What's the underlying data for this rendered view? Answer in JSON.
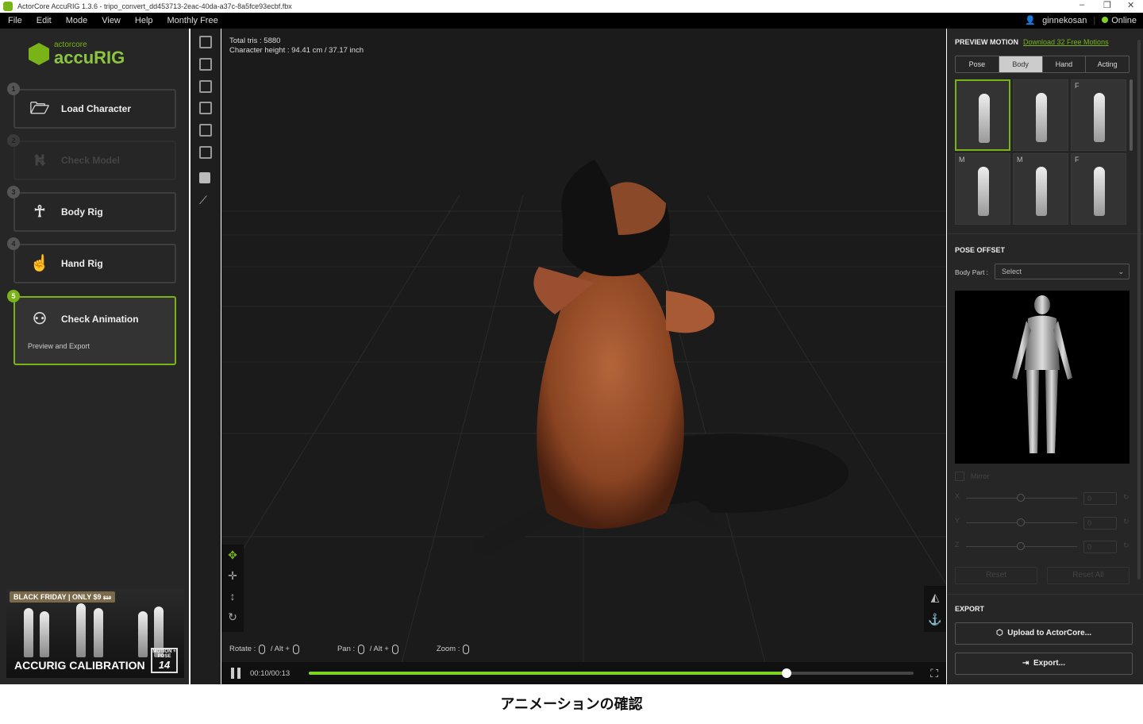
{
  "window": {
    "title": "ActorCore AccuRIG 1.3.6 - tripo_convert_dd453713-2eac-40da-a37c-8a5fce93ecbf.fbx",
    "minimize": "–",
    "restore": "❐",
    "close": "✕"
  },
  "menu": {
    "items": [
      "File",
      "Edit",
      "Mode",
      "View",
      "Help",
      "Monthly Free"
    ],
    "user": "ginnekosan",
    "status": "Online"
  },
  "logo": {
    "brand": "actorcore",
    "product": "accuRIG",
    "color": "#7ab317"
  },
  "steps": [
    {
      "num": "1",
      "label": "Load Character",
      "icon": "folder-download-icon",
      "state": "enabled"
    },
    {
      "num": "2",
      "label": "Check Model",
      "icon": "tpose-icon",
      "state": "disabled"
    },
    {
      "num": "3",
      "label": "Body Rig",
      "icon": "body-icon",
      "state": "enabled"
    },
    {
      "num": "4",
      "label": "Hand Rig",
      "icon": "hand-icon",
      "state": "enabled"
    },
    {
      "num": "5",
      "label": "Check Animation",
      "sublabel": "Preview and Export",
      "icon": "user-check-icon",
      "state": "active"
    }
  ],
  "banner": {
    "tag": "BLACK FRIDAY | ONLY $9",
    "old_price": "$19",
    "title": "ACCURIG CALIBRATION",
    "badge_top": "MOTION + POSE",
    "badge_num": "14"
  },
  "viewport": {
    "tris": "Total tris : 5880",
    "height": "Character height : 94.41 cm / 37.17 inch",
    "hints": {
      "rotate": "Rotate :",
      "pan": "Pan :",
      "zoom": "Zoom :",
      "alt": "/ Alt +"
    },
    "time": "00:10/00:13",
    "progress": 0.79
  },
  "right": {
    "preview_motion": "PREVIEW MOTION",
    "download_link": "Download 32 Free Motions",
    "tabs": [
      "Pose",
      "Body",
      "Hand",
      "Acting"
    ],
    "selected_tab": "Body",
    "thumbs": [
      "",
      "",
      "F",
      "M",
      "M",
      "F"
    ],
    "pose_offset": "POSE OFFSET",
    "body_part_label": "Body Part :",
    "body_part_value": "Select",
    "mirror": "Mirror",
    "axes": [
      "X",
      "Y",
      "Z"
    ],
    "axis_values": [
      "0",
      "0",
      "0"
    ],
    "reset": "Reset",
    "reset_all": "Reset All",
    "export": "EXPORT",
    "upload": "Upload to ActorCore...",
    "export_btn": "Export..."
  },
  "caption": "アニメーションの確認"
}
